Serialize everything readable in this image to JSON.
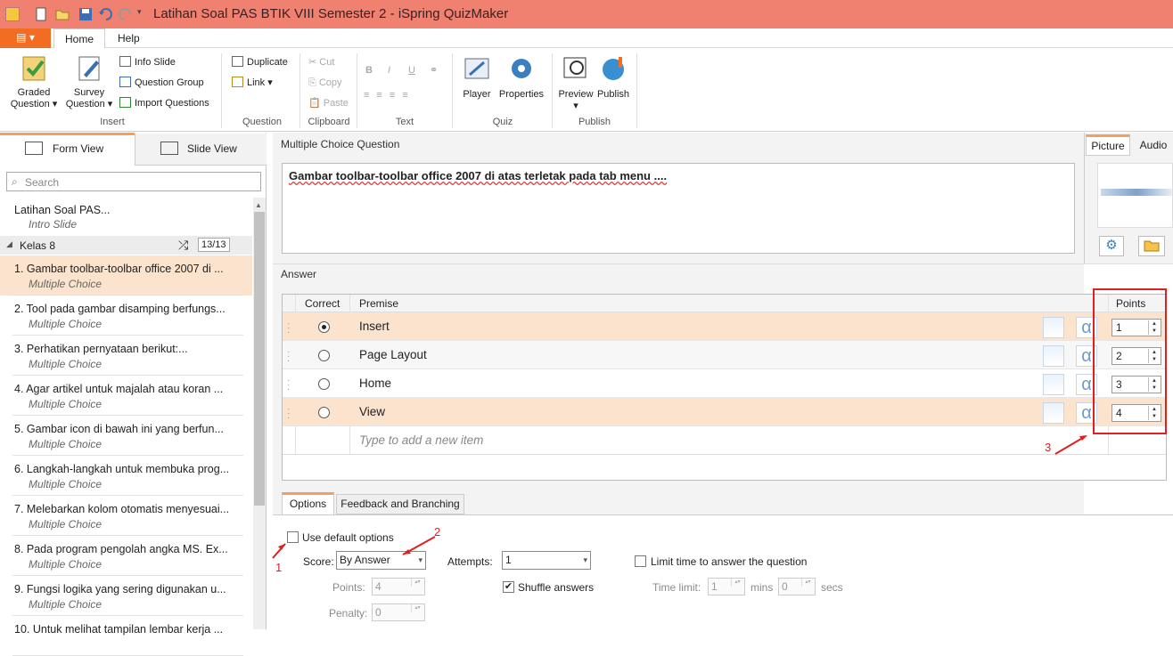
{
  "window": {
    "title": "Latihan Soal PAS BTIK VIII Semester 2 - iSpring QuizMaker"
  },
  "ribbon": {
    "tabs": [
      "Home",
      "Help"
    ],
    "insert": {
      "graded": "Graded",
      "graded2": "Question",
      "survey": "Survey",
      "survey2": "Question",
      "info_slide": "Info Slide",
      "question_group": "Question Group",
      "import_questions": "Import Questions",
      "label": "Insert"
    },
    "question": {
      "duplicate": "Duplicate",
      "link": "Link",
      "label": "Question"
    },
    "clipboard": {
      "cut": "Cut",
      "copy": "Copy",
      "paste": "Paste",
      "label": "Clipboard"
    },
    "text": {
      "bold": "B",
      "italic": "I",
      "underline": "U",
      "label": "Text"
    },
    "quiz": {
      "player": "Player",
      "properties": "Properties",
      "label": "Quiz"
    },
    "publish": {
      "preview": "Preview",
      "publish": "Publish",
      "label": "Publish"
    }
  },
  "left": {
    "form_view": "Form View",
    "slide_view": "Slide View",
    "search_placeholder": "Search",
    "intro": {
      "title": "Latihan Soal PAS...",
      "sub": "Intro Slide"
    },
    "group": {
      "name": "Kelas 8",
      "count": "13/13"
    },
    "items": [
      {
        "title": "1. Gambar toolbar-toolbar office 2007 di ...",
        "sub": "Multiple Choice"
      },
      {
        "title": "2. Tool pada gambar disamping berfungs...",
        "sub": "Multiple Choice"
      },
      {
        "title": "3. Perhatikan pernyataan berikut:...",
        "sub": "Multiple Choice"
      },
      {
        "title": "4. Agar artikel untuk majalah atau koran ...",
        "sub": "Multiple Choice"
      },
      {
        "title": "5. Gambar icon di bawah ini yang berfun...",
        "sub": "Multiple Choice"
      },
      {
        "title": "6. Langkah-langkah untuk membuka prog...",
        "sub": "Multiple Choice"
      },
      {
        "title": "7. Melebarkan kolom otomatis menyesuai...",
        "sub": "Multiple Choice"
      },
      {
        "title": "8. Pada program pengolah angka MS. Ex...",
        "sub": "Multiple Choice"
      },
      {
        "title": "9. Fungsi logika yang sering digunakan u...",
        "sub": "Multiple Choice"
      },
      {
        "title": "10. Untuk melihat tampilan lembar kerja ...",
        "sub": ""
      }
    ]
  },
  "question": {
    "header": "Multiple Choice Question",
    "text": "Gambar toolbar-toolbar office 2007 di atas terletak pada tab menu ...."
  },
  "media_tabs": [
    "Picture",
    "Audio"
  ],
  "answer": {
    "header": "Answer",
    "col_correct": "Correct",
    "col_premise": "Premise",
    "col_points": "Points",
    "rows": [
      {
        "text": "Insert",
        "points": "1",
        "correct": true
      },
      {
        "text": "Page Layout",
        "points": "2",
        "correct": false
      },
      {
        "text": "Home",
        "points": "3",
        "correct": false
      },
      {
        "text": "View",
        "points": "4",
        "correct": false
      }
    ],
    "new_item_placeholder": "Type to add a new item"
  },
  "options": {
    "tabs": [
      "Options",
      "Feedback and Branching"
    ],
    "use_default": "Use default options",
    "score_label": "Score:",
    "score_value": "By Answer",
    "attempts_label": "Attempts:",
    "attempts_value": "1",
    "points_label": "Points:",
    "points_value": "4",
    "penalty_label": "Penalty:",
    "penalty_value": "0",
    "shuffle": "Shuffle answers",
    "limit_time": "Limit time to answer the question",
    "time_limit_label": "Time limit:",
    "mins_value": "1",
    "mins": "mins",
    "secs_value": "0",
    "secs": "secs"
  },
  "annotations": {
    "one": "1",
    "two": "2",
    "three": "3"
  },
  "colors": {
    "titlebar": "#f0806f",
    "file": "#f26d21",
    "selected_row": "#fbe3cd",
    "annotation": "#e02020"
  }
}
